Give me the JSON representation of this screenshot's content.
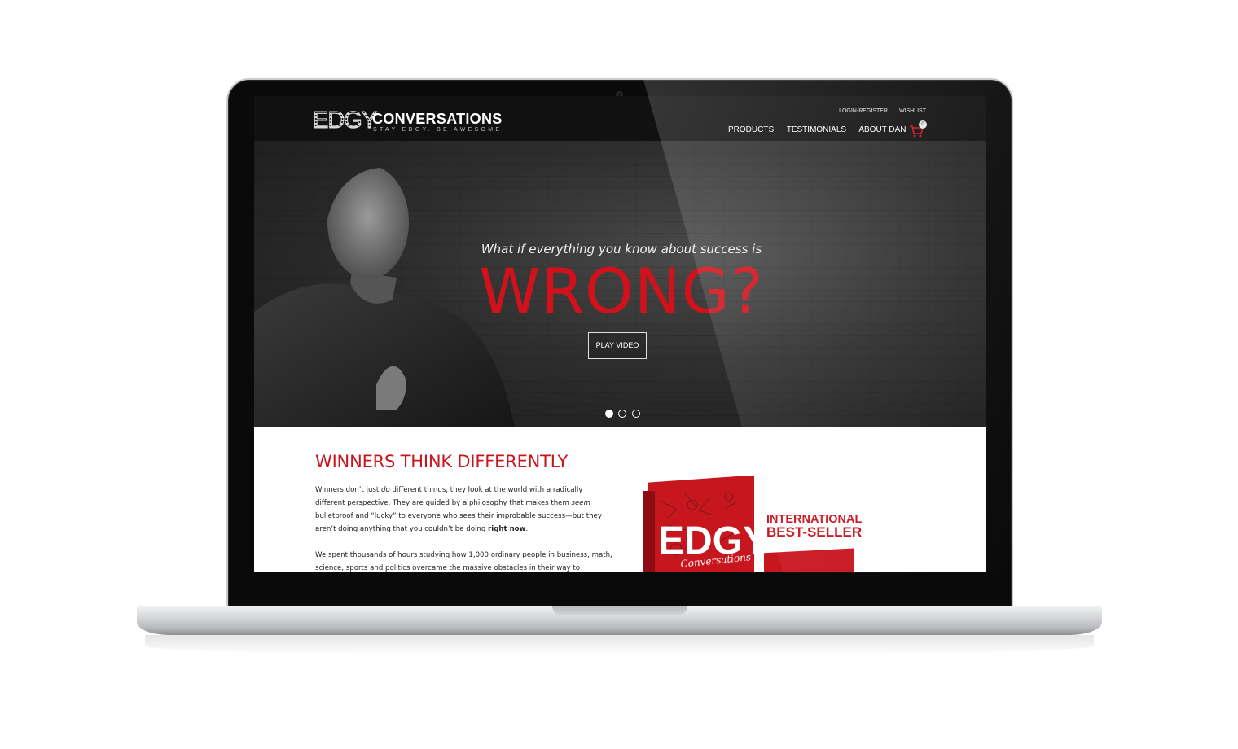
{
  "site": {
    "logo_word": "EDGY",
    "logo_title": "CONVERSATIONS",
    "logo_tagline": "STAY EDGY. BE AWESOME.",
    "util_nav": [
      "LOGIN-REGISTER",
      "WISHLIST"
    ],
    "main_nav": [
      "PRODUCTS",
      "TESTIMONIALS",
      "ABOUT DAN"
    ],
    "cart_count": "0"
  },
  "hero": {
    "question": "What if everything you know about success is",
    "headline": "WRONG?",
    "button": "PLAY VIDEO",
    "slides": 3,
    "active_slide": 1
  },
  "content": {
    "heading": "WINNERS THINK DIFFERENTLY",
    "p1_a": "Winners don’t just ",
    "p1_em1": "do",
    "p1_b": " different things, they look at the world with a radically different perspective. They are guided by a philosophy that makes them ",
    "p1_em2": "seem",
    "p1_c": " bulletproof and “lucky” to everyone who sees their improbable success—but they aren’t doing anything that you couldn’t be doing ",
    "p1_bold": "right now",
    "p1_d": ".",
    "p2": "We spent thousands of hours studying how 1,000 ordinary people in business, math, science, sports and politics overcame the massive obstacles in their way to",
    "badge_line1": "INTERNATIONAL",
    "badge_line2": "BEST-SELLER",
    "book_cover_word": "EDGY",
    "book_cover_script": "Conversations"
  },
  "colors": {
    "accent_red": "#c8161e",
    "header_bg": "#111111",
    "hero_bg": "#2e2e2e"
  }
}
